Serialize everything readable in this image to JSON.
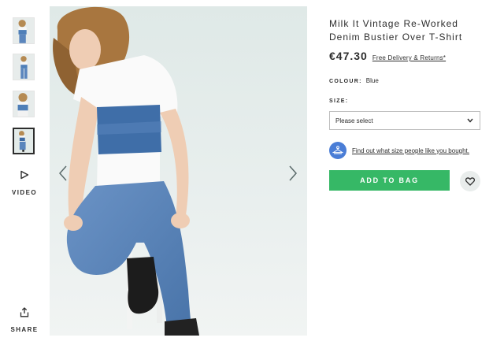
{
  "gallery": {
    "thumbnails": [
      {
        "alt": "thumbnail-1"
      },
      {
        "alt": "thumbnail-2"
      },
      {
        "alt": "thumbnail-3"
      },
      {
        "alt": "thumbnail-4",
        "active": true
      }
    ],
    "video_label": "VIDEO",
    "share_label": "SHARE",
    "prev_icon": "chevron-left-icon",
    "next_icon": "chevron-right-icon"
  },
  "product": {
    "title": "Milk It Vintage Re-Worked Denim Bustier Over T-Shirt",
    "price": "€47.30",
    "delivery_link": "Free Delivery & Returns*",
    "colour_label": "COLOUR:",
    "colour_value": "Blue",
    "size_label": "SIZE:",
    "size_select_value": "Please select",
    "fit_link": "Find out what size people like you bought.",
    "add_to_bag_label": "ADD TO BAG",
    "save_icon": "heart-icon"
  },
  "colors": {
    "add_to_bag": "#36b866",
    "fit_assistant": "#4a7dd6",
    "text": "#2d2d2d"
  }
}
